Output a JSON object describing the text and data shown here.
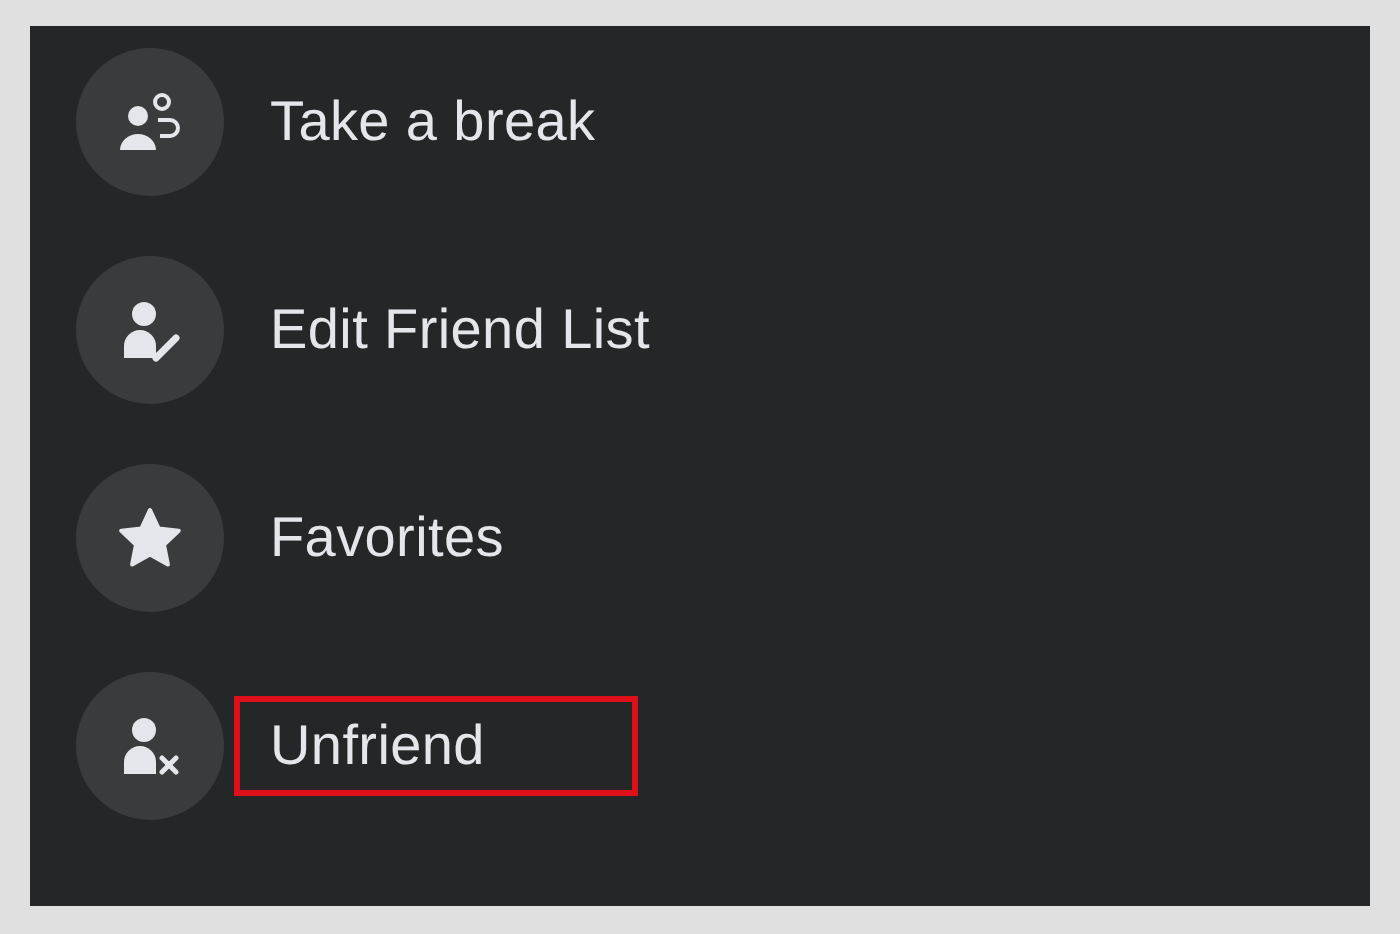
{
  "menu": {
    "items": [
      {
        "kind": "break",
        "label": "Take a break",
        "highlighted": false
      },
      {
        "kind": "edit",
        "label": "Edit Friend List",
        "highlighted": false
      },
      {
        "kind": "star",
        "label": "Favorites",
        "highlighted": false
      },
      {
        "kind": "unfriend",
        "label": "Unfriend",
        "highlighted": true
      }
    ]
  }
}
